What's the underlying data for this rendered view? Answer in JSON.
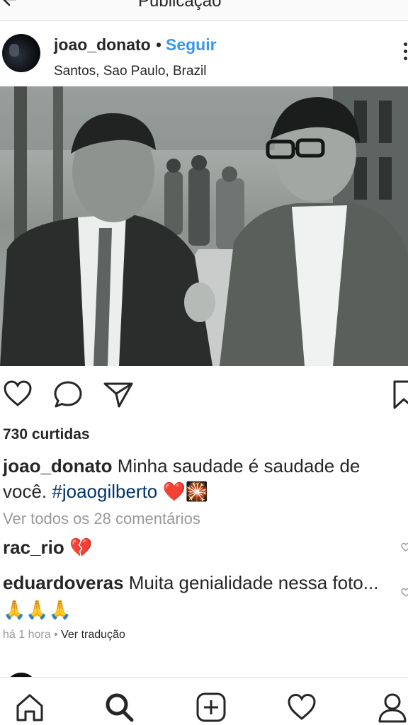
{
  "topbar": {
    "back_icon": "arrow-left-icon",
    "title": "Publicação"
  },
  "post": {
    "username": "joao_donato",
    "separator": "•",
    "follow_label": "Seguir",
    "location": "Santos, Sao Paulo, Brazil",
    "more_icon": "more-vertical-icon"
  },
  "actions": [
    "heart-icon",
    "comment-icon",
    "share-icon",
    "bookmark-icon"
  ],
  "likes": "730 curtidas",
  "caption": {
    "username": "joao_donato",
    "text": " Minha saudade é saudade de você. ",
    "hashtag": "#joaogilberto",
    "emoji": " ❤️🎇"
  },
  "view_all": "Ver todos os 28 comentários",
  "comments": [
    {
      "username": "rac_rio",
      "text": " 💔"
    },
    {
      "username": "eduardoveras",
      "text": " Muita genialidade nessa foto... 🙏🙏🙏"
    }
  ],
  "meta": {
    "time": "há 1 hora",
    "separator": " • ",
    "translate": "Ver tradução"
  },
  "bottom_nav": [
    "home-icon",
    "search-icon",
    "add-post-icon",
    "activity-heart-icon",
    "profile-icon"
  ],
  "colors": {
    "link": "#3897f0",
    "hashtag": "#003569",
    "muted": "#999999",
    "text": "#262626"
  }
}
